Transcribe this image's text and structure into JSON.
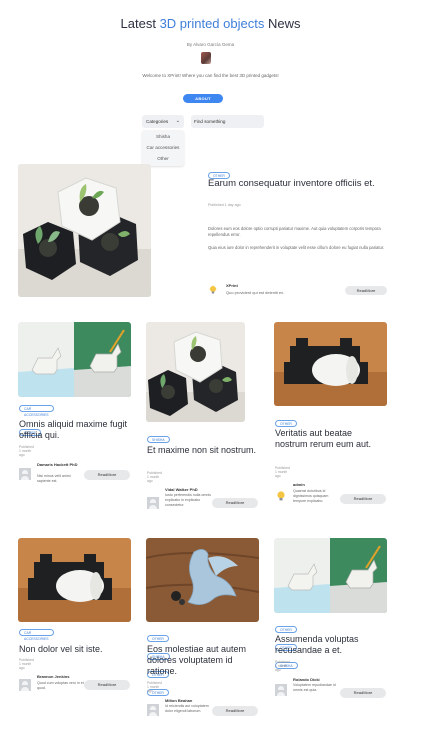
{
  "hero": {
    "title_pre": "Latest ",
    "title_accent": "3D printed objects",
    "title_post": " News",
    "byline": "By Alvaro García Gema",
    "welcome": "Welcome to XPrint! Where you can find the best 3D printed gadgets!",
    "about_label": "ABOUT"
  },
  "filters": {
    "category_label": "Categories",
    "search_placeholder": "Find something",
    "category_options": [
      "Shisha",
      "Car accessories",
      "Other"
    ]
  },
  "featured": {
    "tag": "OTHER",
    "title": "Earum consequatur inventore officiis et.",
    "date": "Published 1 day ago",
    "paragraph1": "Dolores eum eos dolore optio corrupti pariatur maxime. Aut quia voluptatem corporis tempora repellendus error.",
    "paragraph2": "Quia eius iure dolor in reprehenderit in voluptate velit esse cillum dolore eu fugiat nulla pariatur.",
    "author": "XPrint",
    "excerpt": "Quo provident qui est deleniti ex.",
    "read_more": "ReadMore"
  },
  "cards": [
    {
      "tags": [
        "CAR ACCESSORIES",
        "OTHER"
      ],
      "title": "Omnis aliquid maxime fugit officia qui.",
      "date": "Published 1 month ago",
      "author": "Damaris Hackett PhD",
      "excerpt": "Nisi minus velit animi sapiente est.",
      "read_more": "ReadMore"
    },
    {
      "tags": [
        "SHISHA"
      ],
      "title": "Et maxime non sit nostrum.",
      "date": "Published 1 month ago",
      "author": "Vidal Walker PhD",
      "excerpt": "Iusto perferendis nulla omnis explicabo in explicabo consectetur.",
      "read_more": "ReadMore"
    },
    {
      "tags": [
        "OTHER"
      ],
      "title": "Veritatis aut beatae nostrum rerum eum aut.",
      "date": "Published 1 month ago",
      "author": "admin",
      "excerpt": "Quaerat doloribus id dignissimos quisquam tempore explicabo.",
      "read_more": "ReadMore"
    },
    {
      "tags": [
        "CAR ACCESSORIES"
      ],
      "title": "Non dolor vel sit iste.",
      "date": "Published 1 month ago",
      "author": "Brannon Jenkins",
      "excerpt": "Quod cum voluptas vero in et quod.",
      "read_more": "ReadMore"
    },
    {
      "tags": [
        "OTHER",
        "SHISHA",
        "OTHER",
        "OTHER"
      ],
      "title": "Eos molestiae aut autem dolores voluptatem id ratione.",
      "date": "Published 1 month ago",
      "author": "Milton Beahan",
      "excerpt": "Id reiciendis aut voluptatem dolor eligendi laborum.",
      "read_more": "ReadMore"
    },
    {
      "tags": [
        "OTHER",
        "OTHER",
        "SHISHA"
      ],
      "title": "Assumenda voluptas recusandae a et.",
      "date": "Published 1 month ago",
      "author": "Rolando Dicki",
      "excerpt": "Voluptatem repudiandae id omnis est quia.",
      "read_more": "ReadMore"
    }
  ]
}
